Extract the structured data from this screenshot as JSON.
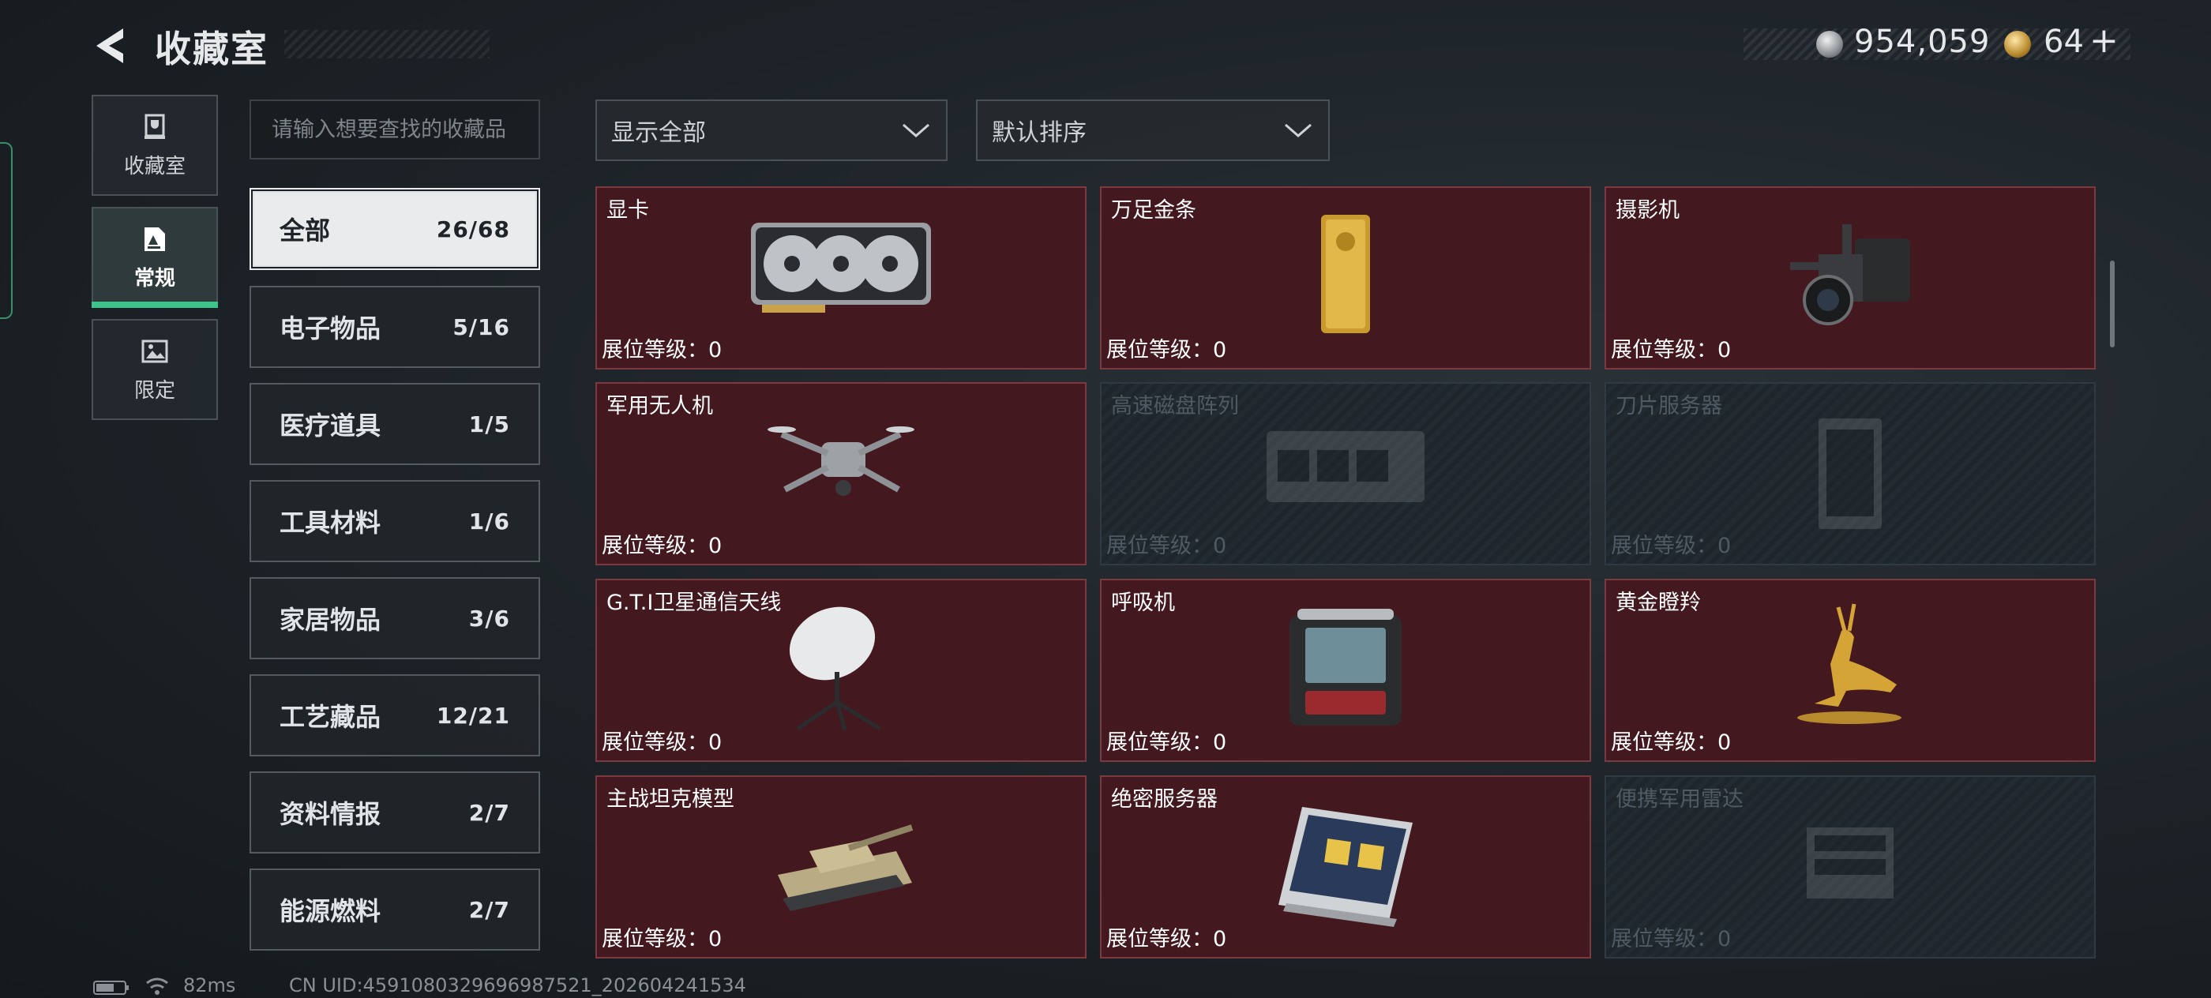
{
  "header": {
    "title": "收藏室",
    "silver": "954,059",
    "gold": "64",
    "gold_plus": "+"
  },
  "left_tabs": [
    {
      "label": "收藏室",
      "icon": "trophy-icon"
    },
    {
      "label": "常规",
      "icon": "document-icon"
    },
    {
      "label": "限定",
      "icon": "image-icon"
    }
  ],
  "search": {
    "placeholder": "请输入想要查找的收藏品"
  },
  "filters": {
    "filter_label": "显示全部",
    "sort_label": "默认排序"
  },
  "categories": [
    {
      "label": "全部",
      "count": "26/68"
    },
    {
      "label": "电子物品",
      "count": "5/16"
    },
    {
      "label": "医疗道具",
      "count": "1/5"
    },
    {
      "label": "工具材料",
      "count": "1/6"
    },
    {
      "label": "家居物品",
      "count": "3/6"
    },
    {
      "label": "工艺藏品",
      "count": "12/21"
    },
    {
      "label": "资料情报",
      "count": "2/7"
    },
    {
      "label": "能源燃料",
      "count": "2/7"
    }
  ],
  "items": [
    {
      "name": "显卡",
      "level": "展位等级：0",
      "icon": "graphics-card-icon",
      "unlocked": true
    },
    {
      "name": "万足金条",
      "level": "展位等级：0",
      "icon": "gold-bar-icon",
      "unlocked": true
    },
    {
      "name": "摄影机",
      "level": "展位等级：0",
      "icon": "camera-icon",
      "unlocked": true
    },
    {
      "name": "军用无人机",
      "level": "展位等级：0",
      "icon": "drone-icon",
      "unlocked": true
    },
    {
      "name": "高速磁盘阵列",
      "level": "展位等级：0",
      "icon": "disk-array-icon",
      "unlocked": false
    },
    {
      "name": "刀片服务器",
      "level": "展位等级：0",
      "icon": "blade-server-icon",
      "unlocked": false
    },
    {
      "name": "G.T.I卫星通信天线",
      "level": "展位等级：0",
      "icon": "satellite-dish-icon",
      "unlocked": true
    },
    {
      "name": "呼吸机",
      "level": "展位等级：0",
      "icon": "ventilator-icon",
      "unlocked": true
    },
    {
      "name": "黄金瞪羚",
      "level": "展位等级：0",
      "icon": "golden-gazelle-icon",
      "unlocked": true
    },
    {
      "name": "主战坦克模型",
      "level": "展位等级：0",
      "icon": "tank-model-icon",
      "unlocked": true
    },
    {
      "name": "绝密服务器",
      "level": "展位等级：0",
      "icon": "server-icon",
      "unlocked": true
    },
    {
      "name": "便携军用雷达",
      "level": "展位等级：0",
      "icon": "radar-icon",
      "unlocked": false
    }
  ],
  "footer": {
    "ping": "82ms",
    "uid": "CN UID:4591080329696987521_202604241534"
  }
}
